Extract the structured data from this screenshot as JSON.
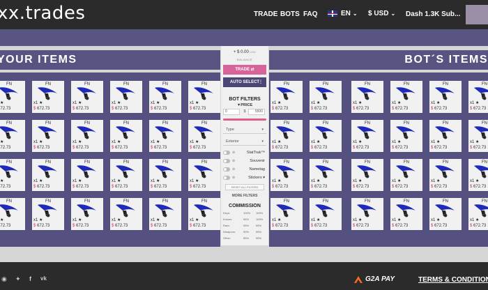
{
  "header": {
    "logo": "xx.trades",
    "nav": {
      "trade": "TRADE",
      "bots": "BOTS",
      "faq": "FAQ"
    },
    "language": "EN",
    "currency": "$ USD",
    "user": "Dash 1.3K Sub..."
  },
  "sections": {
    "your_items": "YOUR ITEMS",
    "bot_items": "BOT´S ITEMS"
  },
  "item_card": {
    "wear": "FN",
    "quantity": "x1 ★",
    "price_symbol": "$",
    "price": "672.73"
  },
  "middle": {
    "balance_value": "+ $ 0.00",
    "balance_unit": "USD",
    "balance_label": "BALANCE",
    "trade_label": "TRADE ⇄",
    "auto_select_label": "AUTO SELECT",
    "filters_title": "BOT FILTERS",
    "price_label": "▼PRICE",
    "price_min": "0",
    "price_sep": "$",
    "price_max": "5500",
    "type_label": "Type",
    "exterior_label": "Exterior",
    "toggles": [
      {
        "label": "StatTrak™"
      },
      {
        "label": "Souvenir"
      },
      {
        "label": "Nametag"
      },
      {
        "label": "Stickers ▾"
      }
    ],
    "reset_label": "RESET ALL FILTERS",
    "more_filters_label": "MORE FILTERS"
  },
  "commission": {
    "title": "COMMISSION",
    "rows": [
      {
        "label": "Keys:",
        "a": "100%",
        "b": "100%"
      },
      {
        "label": "Knives:",
        "a": "95%",
        "b": "100%"
      },
      {
        "label": "Rare:",
        "a": "95%",
        "b": "95%"
      },
      {
        "label": "Weapons:",
        "a": "90%",
        "b": "95%"
      },
      {
        "label": "Other:",
        "a": "85%",
        "b": "95%"
      }
    ]
  },
  "footer": {
    "g2a_label": "G2A PAY",
    "terms_label": "TERMS & CONDITIONS"
  },
  "colors": {
    "header_bg": "#2b2b2b",
    "panel_purple": "#545080",
    "accent_pink": "#d6649a",
    "knife_blue": "#1f2bb8"
  }
}
